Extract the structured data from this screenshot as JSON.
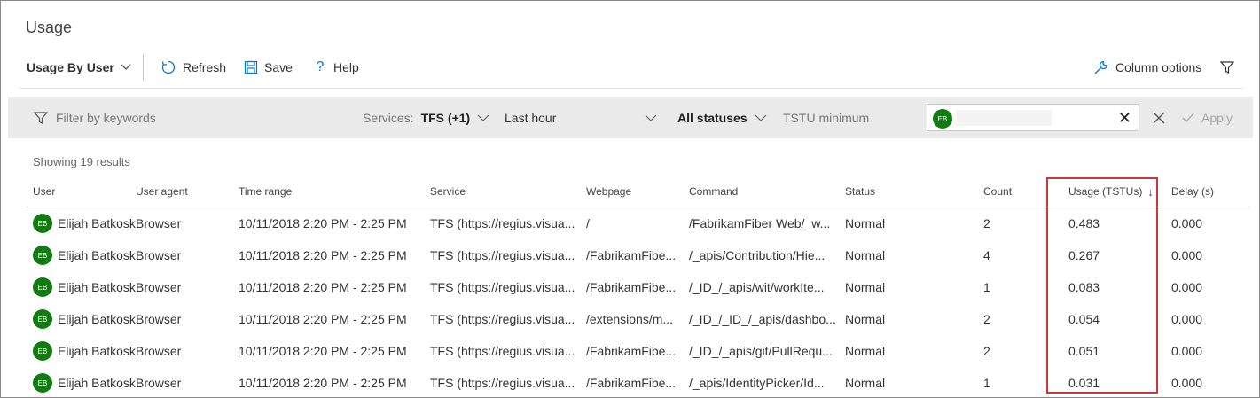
{
  "page": {
    "title": "Usage"
  },
  "toolbar": {
    "view_label": "Usage By User",
    "refresh_label": "Refresh",
    "save_label": "Save",
    "help_label": "Help",
    "column_options_label": "Column options"
  },
  "filters": {
    "keyword_placeholder": "Filter by keywords",
    "services_label": "Services:",
    "services_value": "TFS (+1)",
    "time_value": "Last hour",
    "status_value": "All statuses",
    "tstu_placeholder": "TSTU minimum",
    "user_initials": "EB",
    "apply_label": "Apply"
  },
  "results": {
    "summary": "Showing 19 results"
  },
  "table": {
    "columns": [
      "User",
      "User agent",
      "Time range",
      "Service",
      "Webpage",
      "Command",
      "Status",
      "Count",
      "Usage (TSTUs)",
      "Delay (s)"
    ],
    "sort_indicator": "↓",
    "rows": [
      {
        "initials": "EB",
        "user": "Elijah Batkoskl",
        "agent": "Browser",
        "time": "10/11/2018 2:20 PM - 2:25 PM",
        "service": "TFS (https://regius.visua...",
        "webpage": "/",
        "command": "/FabrikamFiber Web/_w...",
        "status": "Normal",
        "count": "2",
        "usage": "0.483",
        "delay": "0.000"
      },
      {
        "initials": "EB",
        "user": "Elijah Batkoskl",
        "agent": "Browser",
        "time": "10/11/2018 2:20 PM - 2:25 PM",
        "service": "TFS (https://regius.visua...",
        "webpage": "/FabrikamFibe...",
        "command": "/_apis/Contribution/Hie...",
        "status": "Normal",
        "count": "4",
        "usage": "0.267",
        "delay": "0.000"
      },
      {
        "initials": "EB",
        "user": "Elijah Batkoskl",
        "agent": "Browser",
        "time": "10/11/2018 2:20 PM - 2:25 PM",
        "service": "TFS (https://regius.visua...",
        "webpage": "/FabrikamFibe...",
        "command": "/_ID_/_apis/wit/workIte...",
        "status": "Normal",
        "count": "1",
        "usage": "0.083",
        "delay": "0.000"
      },
      {
        "initials": "EB",
        "user": "Elijah Batkoskl",
        "agent": "Browser",
        "time": "10/11/2018 2:20 PM - 2:25 PM",
        "service": "TFS (https://regius.visua...",
        "webpage": "/extensions/m...",
        "command": "/_ID_/_ID_/_apis/dashbo...",
        "status": "Normal",
        "count": "2",
        "usage": "0.054",
        "delay": "0.000"
      },
      {
        "initials": "EB",
        "user": "Elijah Batkoskl",
        "agent": "Browser",
        "time": "10/11/2018 2:20 PM - 2:25 PM",
        "service": "TFS (https://regius.visua...",
        "webpage": "/FabrikamFibe...",
        "command": "/_ID_/_apis/git/PullRequ...",
        "status": "Normal",
        "count": "2",
        "usage": "0.051",
        "delay": "0.000"
      },
      {
        "initials": "EB",
        "user": "Elijah Batkoskl",
        "agent": "Browser",
        "time": "10/11/2018 2:20 PM - 2:25 PM",
        "service": "TFS (https://regius.visua...",
        "webpage": "/FabrikamFibe...",
        "command": "/_apis/IdentityPicker/Id...",
        "status": "Normal",
        "count": "1",
        "usage": "0.031",
        "delay": "0.000"
      }
    ]
  },
  "colors": {
    "avatar": "#107c10",
    "highlight": "#d13438",
    "filterbar": "#eaeaea"
  }
}
